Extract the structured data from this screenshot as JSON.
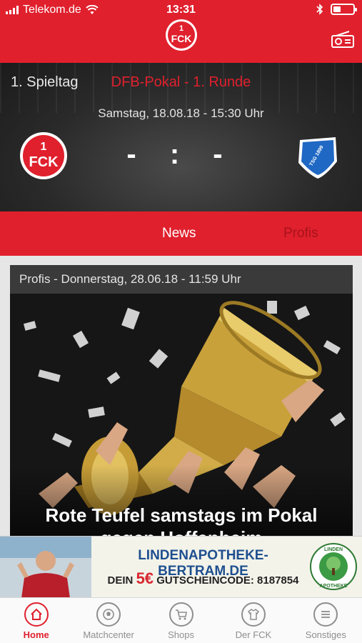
{
  "status_bar": {
    "carrier": "Telekom.de",
    "time": "13:31"
  },
  "match": {
    "matchday": "1. Spieltag",
    "competition": "DFB-Pokal - 1. Runde",
    "datetime": "Samstag, 18.08.18 - 15:30 Uhr",
    "score": "- : -",
    "home_logo_text": "1FCK",
    "away_logo_text": "TSG 1899 Hoffenheim"
  },
  "tabs": [
    {
      "label": "News",
      "active": true
    },
    {
      "label": "Profis",
      "active": false
    }
  ],
  "news_card": {
    "meta": "Profis - Donnerstag, 28.06.18 - 11:59 Uhr",
    "title": "Rote Teufel samstags im Pokal gegen Hoffenheim"
  },
  "ad": {
    "url": "LINDENAPOTHEKE-BERTRAM.DE",
    "code_prefix": "DEIN",
    "amount": "5€",
    "code_text": "GUTSCHEINCODE: 8187854",
    "badge_top": "LINDEN",
    "badge_bottom": "APOTHEKE"
  },
  "bottom_nav": [
    {
      "label": "Home",
      "icon": "home-icon",
      "active": true
    },
    {
      "label": "Matchcenter",
      "icon": "soccer-ball-icon",
      "active": false
    },
    {
      "label": "Shops",
      "icon": "cart-icon",
      "active": false
    },
    {
      "label": "Der FCK",
      "icon": "jersey-icon",
      "active": false
    },
    {
      "label": "Sonstiges",
      "icon": "menu-icon",
      "active": false
    }
  ],
  "colors": {
    "brand_red": "#e0202d",
    "inactive_tab": "#a8121c",
    "ad_blue": "#1e4f8f"
  }
}
